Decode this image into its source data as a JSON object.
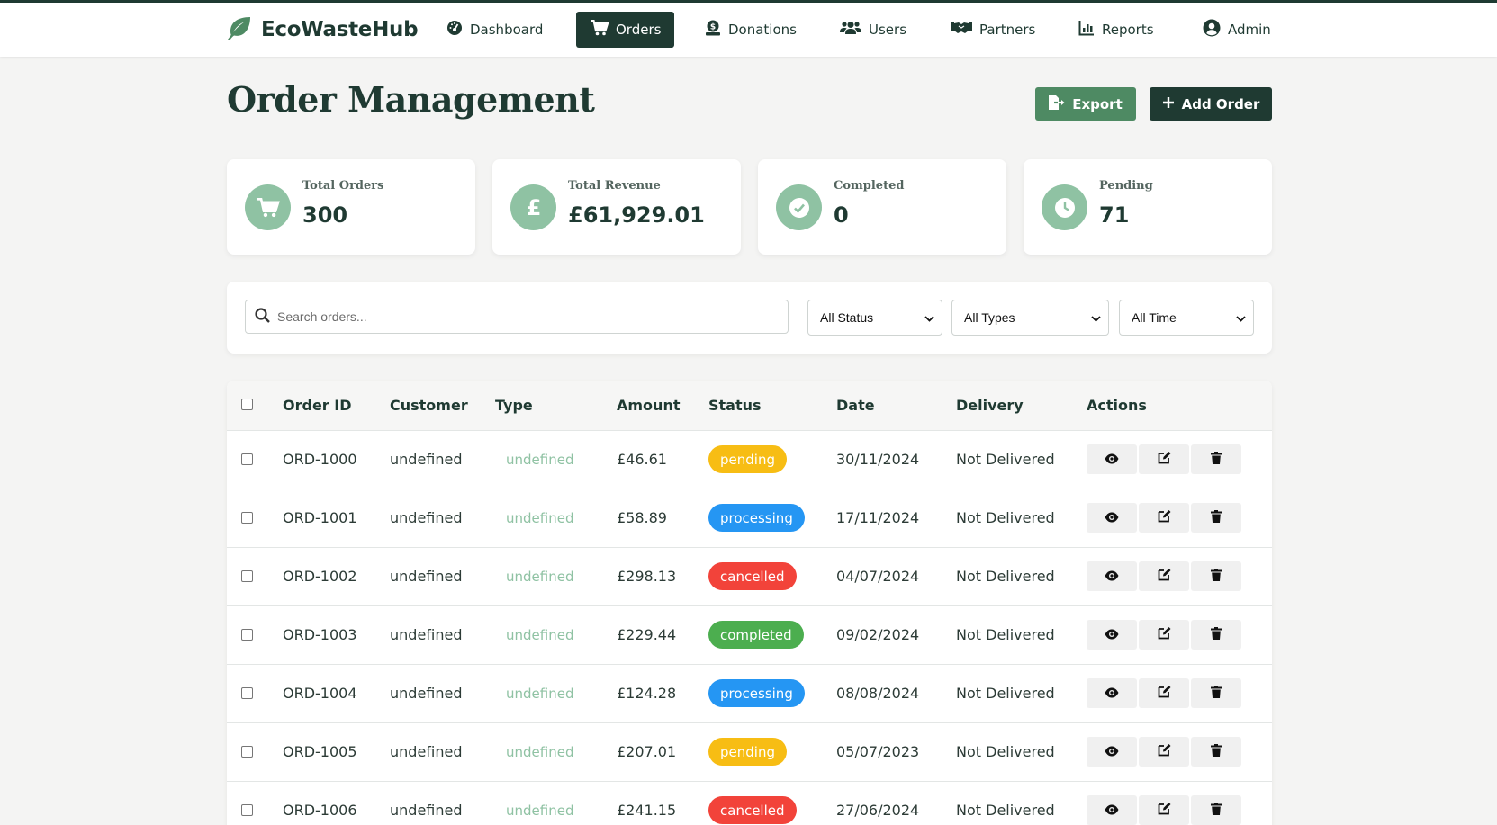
{
  "app": {
    "brand": "EcoWasteHub"
  },
  "nav": {
    "dashboard": "Dashboard",
    "orders": "Orders",
    "donations": "Donations",
    "users": "Users",
    "partners": "Partners",
    "reports": "Reports",
    "admin": "Admin"
  },
  "page": {
    "title": "Order Management",
    "export_label": "Export",
    "add_label": "Add Order"
  },
  "stats": {
    "total_orders": {
      "label": "Total Orders",
      "value": "300"
    },
    "total_revenue": {
      "label": "Total Revenue",
      "value": "£61,929.01"
    },
    "completed": {
      "label": "Completed",
      "value": "0"
    },
    "pending": {
      "label": "Pending",
      "value": "71"
    }
  },
  "filters": {
    "search_placeholder": "Search orders...",
    "status": "All Status",
    "type": "All Types",
    "time": "All Time"
  },
  "table": {
    "headers": {
      "order_id": "Order ID",
      "customer": "Customer",
      "type": "Type",
      "amount": "Amount",
      "status": "Status",
      "date": "Date",
      "delivery": "Delivery",
      "actions": "Actions"
    },
    "rows": [
      {
        "id": "ORD-1000",
        "customer": "undefined",
        "type": "undefined",
        "amount": "£46.61",
        "status": "pending",
        "date": "30/11/2024",
        "delivery": "Not Delivered"
      },
      {
        "id": "ORD-1001",
        "customer": "undefined",
        "type": "undefined",
        "amount": "£58.89",
        "status": "processing",
        "date": "17/11/2024",
        "delivery": "Not Delivered"
      },
      {
        "id": "ORD-1002",
        "customer": "undefined",
        "type": "undefined",
        "amount": "£298.13",
        "status": "cancelled",
        "date": "04/07/2024",
        "delivery": "Not Delivered"
      },
      {
        "id": "ORD-1003",
        "customer": "undefined",
        "type": "undefined",
        "amount": "£229.44",
        "status": "completed",
        "date": "09/02/2024",
        "delivery": "Not Delivered"
      },
      {
        "id": "ORD-1004",
        "customer": "undefined",
        "type": "undefined",
        "amount": "£124.28",
        "status": "processing",
        "date": "08/08/2024",
        "delivery": "Not Delivered"
      },
      {
        "id": "ORD-1005",
        "customer": "undefined",
        "type": "undefined",
        "amount": "£207.01",
        "status": "pending",
        "date": "05/07/2023",
        "delivery": "Not Delivered"
      },
      {
        "id": "ORD-1006",
        "customer": "undefined",
        "type": "undefined",
        "amount": "£241.15",
        "status": "cancelled",
        "date": "27/06/2024",
        "delivery": "Not Delivered"
      }
    ]
  },
  "colors": {
    "primary": "#1f3a32",
    "accent": "#4e8a63",
    "icon_bg": "#8fc2a3",
    "status_pending": "#f7bd14",
    "status_processing": "#2596f3",
    "status_cancelled": "#f2433a",
    "status_completed": "#4cae4f"
  }
}
